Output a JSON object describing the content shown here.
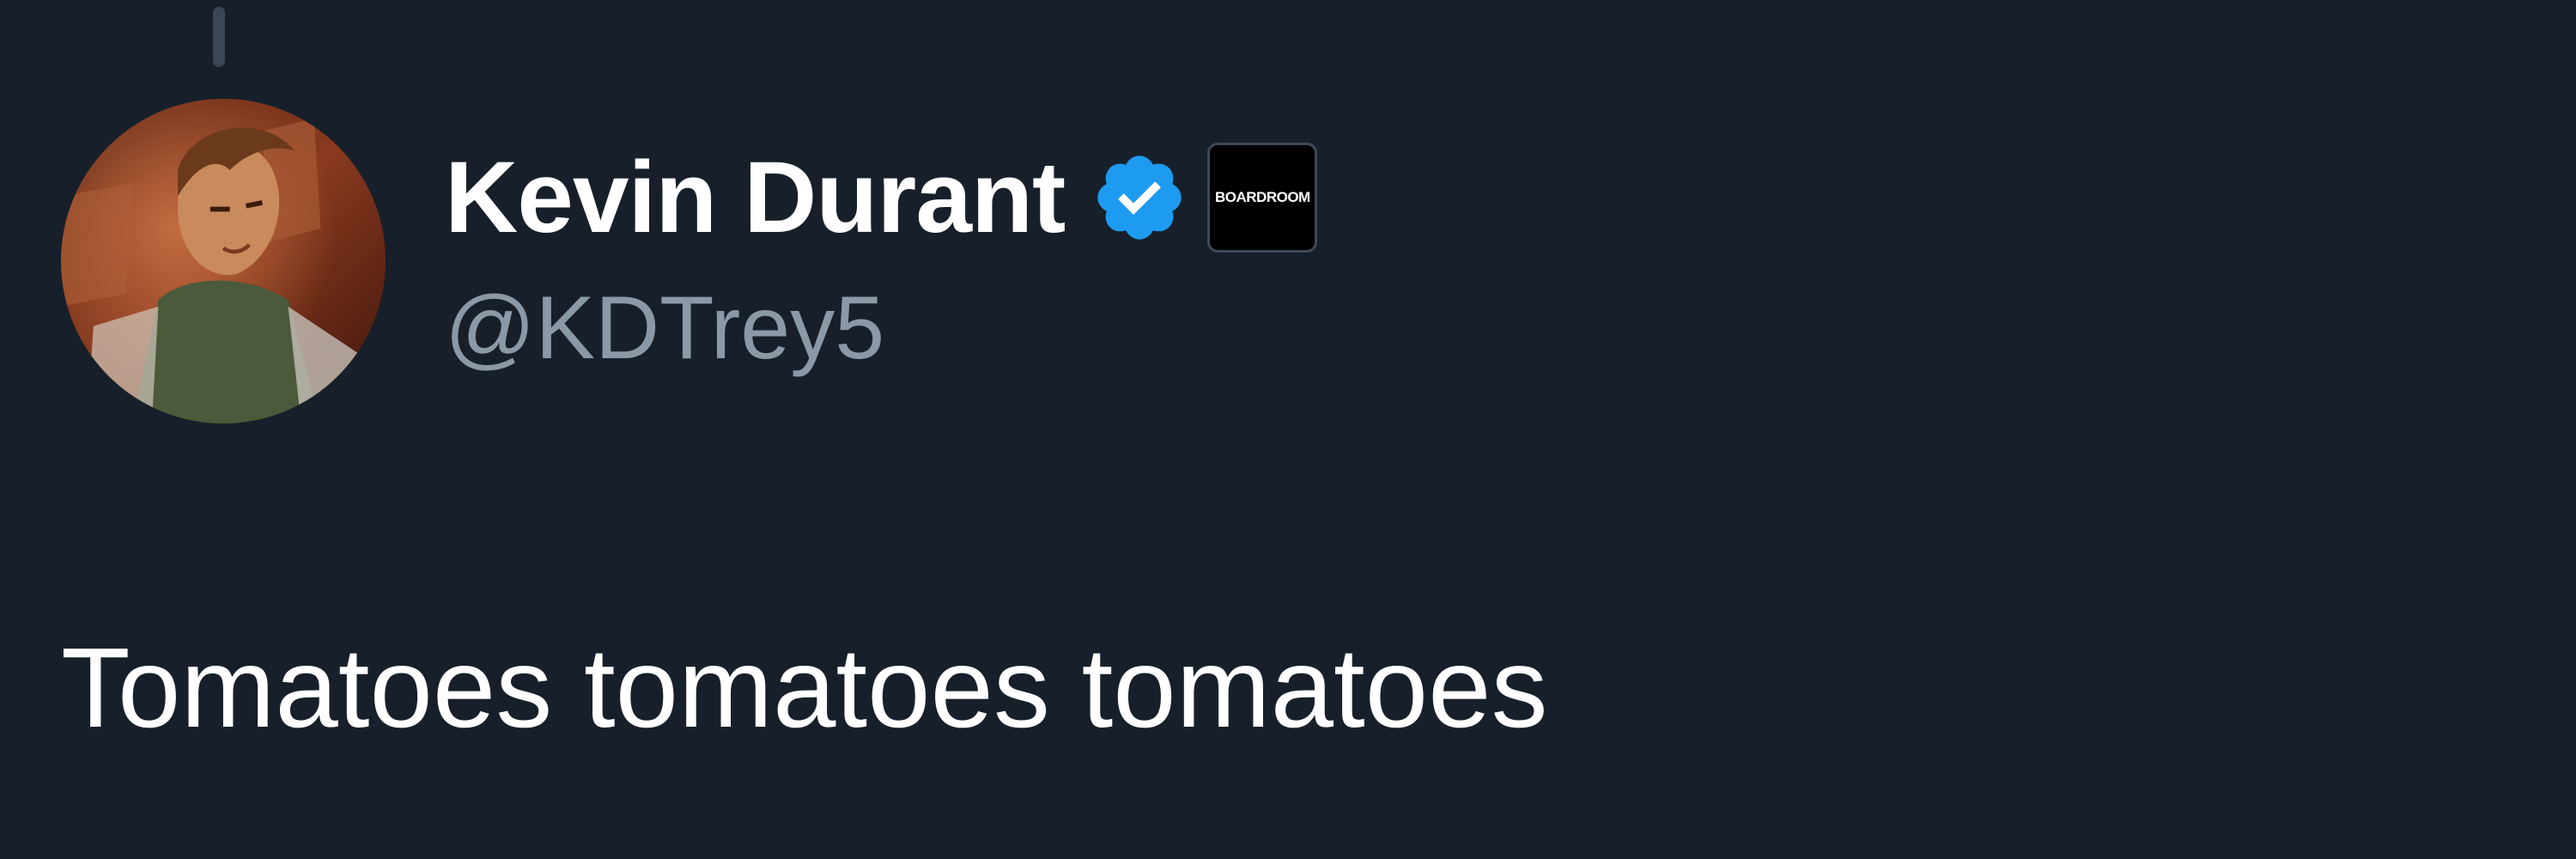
{
  "tweet": {
    "author": {
      "display_name": "Kevin Durant",
      "handle": "@KDTrey5",
      "verified_icon": "verified-badge-icon",
      "affiliate_badge_text": "BOARDROOM",
      "avatar_icon": "profile-avatar"
    },
    "text": "Tomatoes tomatoes tomatoes"
  },
  "colors": {
    "background": "#17202a",
    "name_text": "#ffffff",
    "handle_text": "#8b98a5",
    "verified_blue": "#1d9bf0",
    "affiliate_bg": "#000000"
  }
}
